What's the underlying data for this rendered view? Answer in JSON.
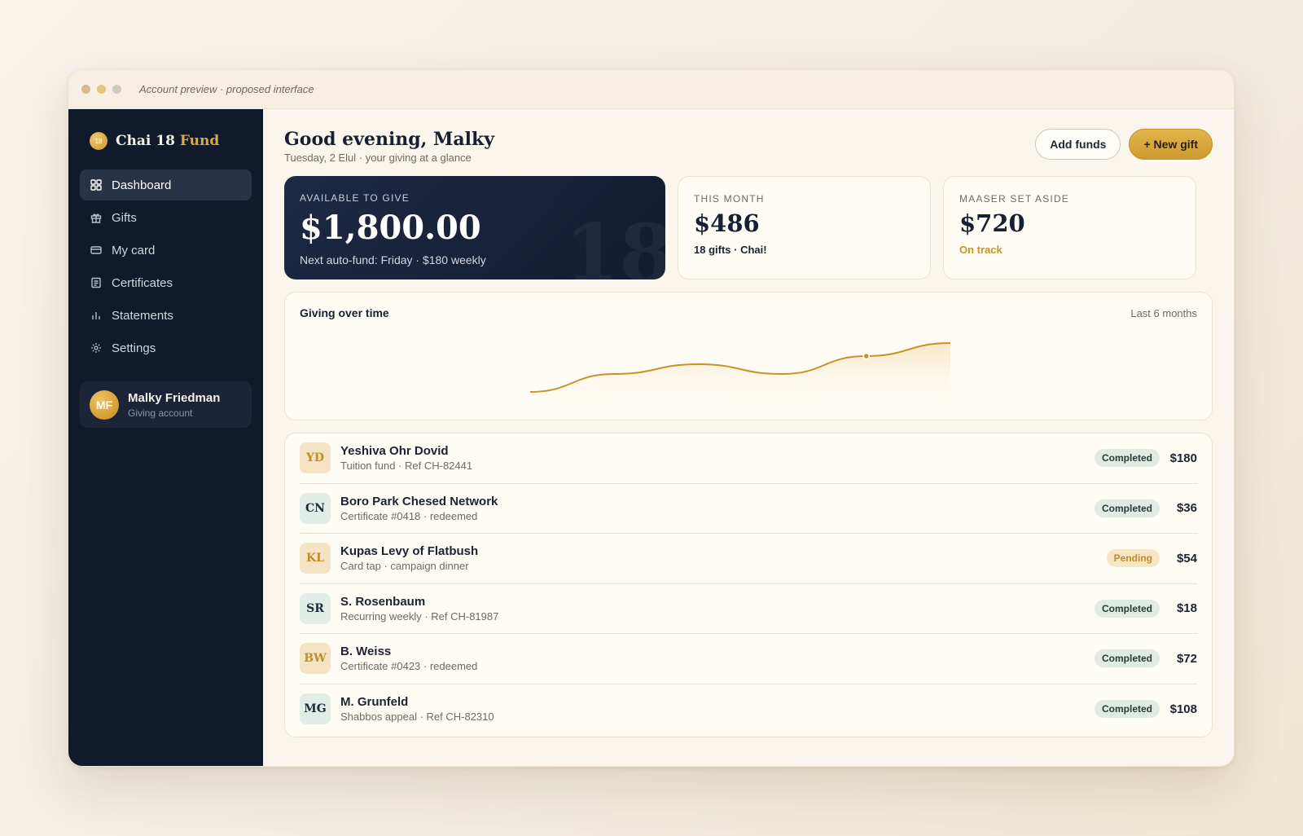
{
  "window": {
    "title": "Account preview · proposed interface",
    "dot_colors": [
      "#d9b98a",
      "#e7c479",
      "#cfcac0"
    ]
  },
  "brand": {
    "name_a": "Chai 18 ",
    "name_b": "Fund",
    "coin": "18",
    "accent": "#d9a944"
  },
  "sidebar": {
    "items": [
      {
        "label": "Dashboard",
        "icon": "grid-icon",
        "active": true
      },
      {
        "label": "Gifts",
        "icon": "gift-icon",
        "active": false
      },
      {
        "label": "My card",
        "icon": "card-icon",
        "active": false
      },
      {
        "label": "Certificates",
        "icon": "certificate-icon",
        "active": false
      },
      {
        "label": "Statements",
        "icon": "bar-chart-icon",
        "active": false
      },
      {
        "label": "Settings",
        "icon": "gear-icon",
        "active": false
      }
    ],
    "user": {
      "initials": "MF",
      "name": "Malky Friedman",
      "role": "Giving account"
    }
  },
  "header": {
    "greeting": "Good evening, Malky",
    "subtitle": "Tuesday, 2 Elul · your giving at a glance",
    "add_funds": "Add funds",
    "new_gift": "+ New gift"
  },
  "stats": {
    "available": {
      "label": "AVAILABLE TO GIVE",
      "value": "$1,800.00",
      "note": "Next auto-fund: Friday · $180 weekly",
      "watermark": "18"
    },
    "month": {
      "label": "THIS MONTH",
      "value": "$486",
      "note": "18 gifts · Chai!"
    },
    "maaser": {
      "label": "MAASER SET ASIDE",
      "value": "$720",
      "note": "On track"
    }
  },
  "chart": {
    "title": "Giving over time",
    "range": "Last 6 months",
    "color": "#c99228"
  },
  "chart_data": {
    "type": "area",
    "title": "Giving over time",
    "x": [
      1,
      2,
      3,
      4,
      5,
      6
    ],
    "series": [
      {
        "values": [
          18,
          40,
          52,
          40,
          62,
          78
        ]
      }
    ],
    "highlight_index": 4,
    "ylim": [
      0,
      100
    ],
    "grid": false
  },
  "transactions": [
    {
      "initials": "YD",
      "tone": "gold",
      "name": "Yeshiva Ohr Dovid",
      "detail": "Tuition fund · Ref CH-82441",
      "status": "Completed",
      "amount": "$180"
    },
    {
      "initials": "CN",
      "tone": "teal",
      "name": "Boro Park Chesed Network",
      "detail": "Certificate #0418 · redeemed",
      "status": "Completed",
      "amount": "$36"
    },
    {
      "initials": "KL",
      "tone": "gold",
      "name": "Kupas Levy of Flatbush",
      "detail": "Card tap · campaign dinner",
      "status": "Pending",
      "amount": "$54"
    },
    {
      "initials": "SR",
      "tone": "teal",
      "name": "S. Rosenbaum",
      "detail": "Recurring weekly · Ref CH-81987",
      "status": "Completed",
      "amount": "$18"
    },
    {
      "initials": "BW",
      "tone": "gold",
      "name": "B. Weiss",
      "detail": "Certificate #0423 · redeemed",
      "status": "Completed",
      "amount": "$72"
    },
    {
      "initials": "MG",
      "tone": "teal",
      "name": "M. Grunfeld",
      "detail": "Shabbos appeal · Ref CH-82310",
      "status": "Completed",
      "amount": "$108"
    }
  ]
}
